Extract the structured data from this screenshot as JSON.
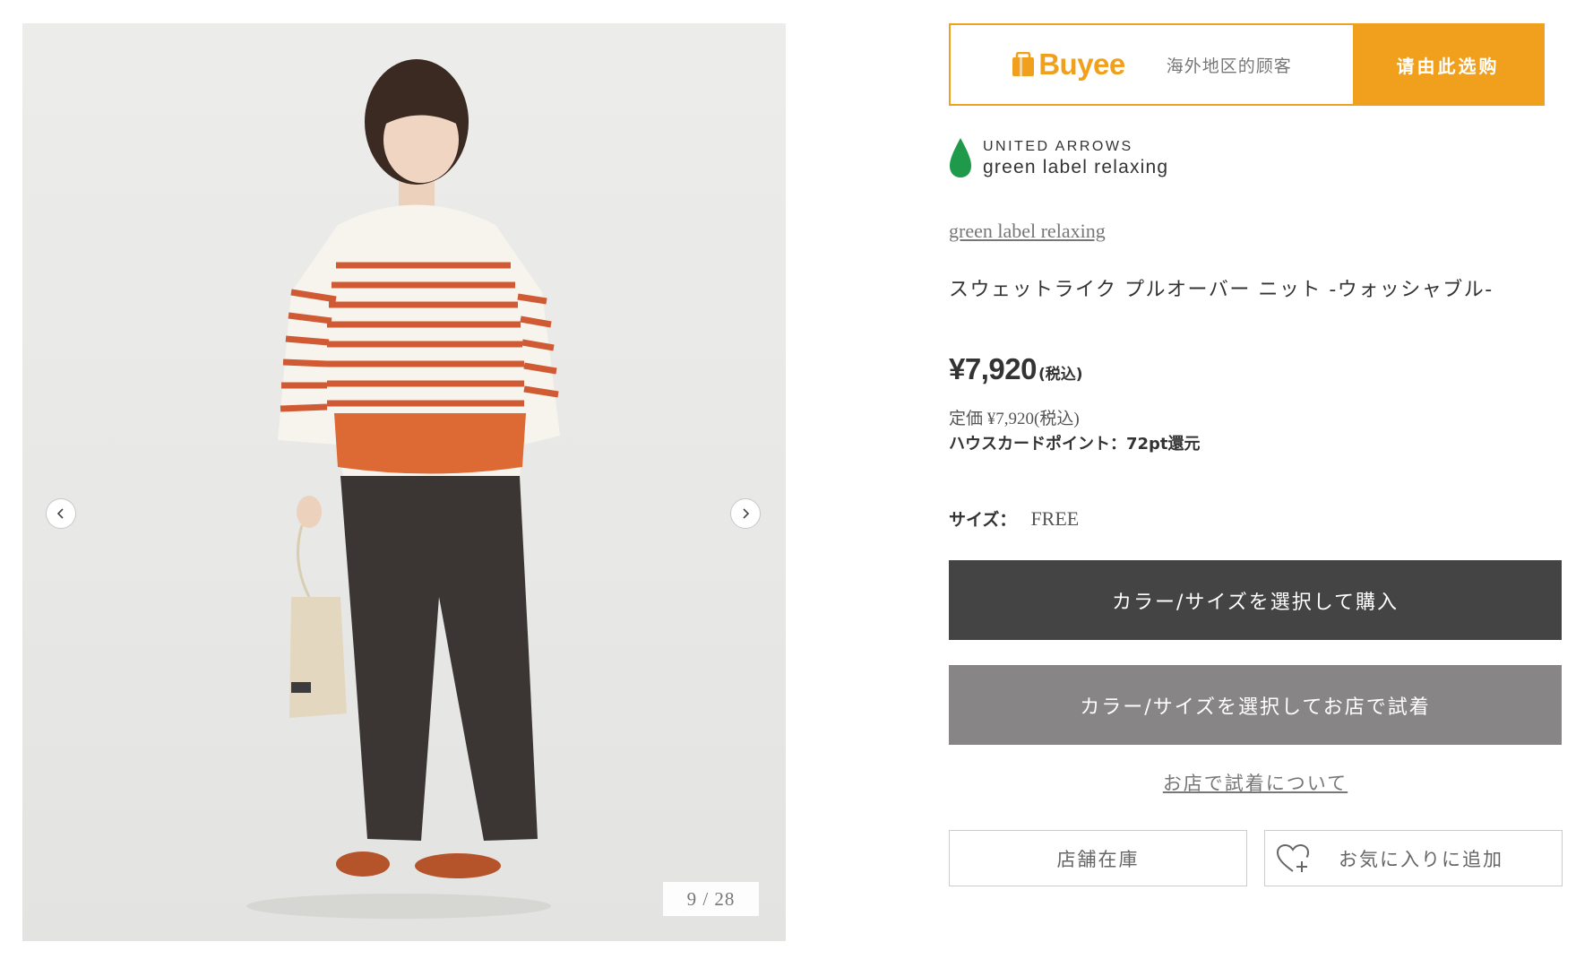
{
  "gallery": {
    "counter": "9 / 28",
    "prev_icon": "chevron-left-icon",
    "next_icon": "chevron-right-icon"
  },
  "buyee": {
    "logo_text": "Buyee",
    "tagline": "海外地区的顾客",
    "button_label": "请由此选购",
    "color": "#f0a01c"
  },
  "brand": {
    "logo_top": "UNITED ARROWS",
    "logo_bottom": "green label relaxing",
    "leaf_color": "#1f9a4a",
    "link": "green label relaxing"
  },
  "product": {
    "name": "スウェットライク プルオーバー ニット -ウォッシャブル-",
    "price": "¥7,920",
    "price_tax_note": "(税込)",
    "list_price": "定価 ¥7,920(税込)",
    "points": "ハウスカードポイント：72pt還元",
    "size_label": "サイズ：",
    "size_value": "FREE"
  },
  "actions": {
    "buy_label": "カラー/サイズを選択して購入",
    "try_label": "カラー/サイズを選択してお店で試着",
    "try_info_link": "お店で試着について",
    "stock_label": "店舗在庫",
    "favorite_label": "お気に入りに追加",
    "favorite_icon": "heart-plus-icon"
  }
}
